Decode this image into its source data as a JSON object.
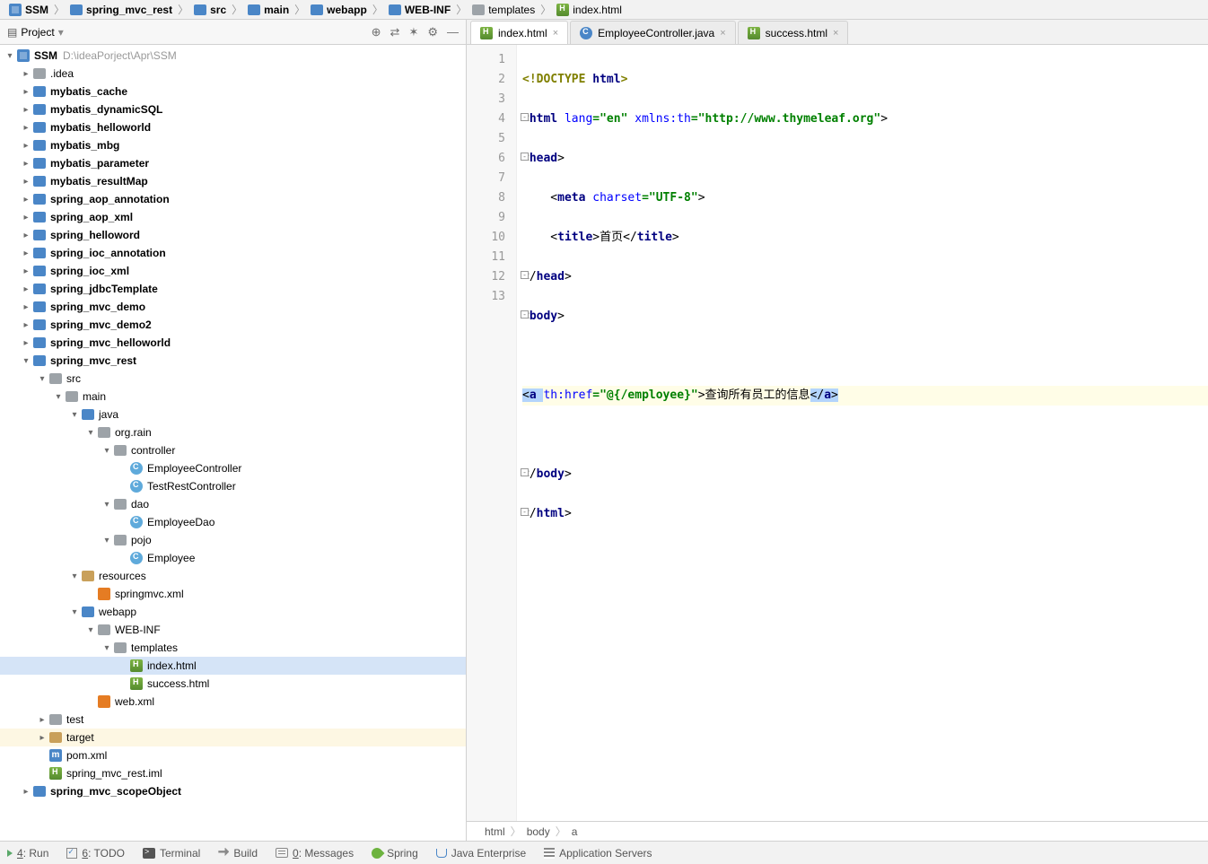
{
  "breadcrumbs": [
    {
      "icon": "sq",
      "label": "SSM"
    },
    {
      "icon": "folder-blue",
      "label": "spring_mvc_rest"
    },
    {
      "icon": "folder-blue",
      "label": "src"
    },
    {
      "icon": "folder-blue",
      "label": "main"
    },
    {
      "icon": "folder-blue",
      "label": "webapp"
    },
    {
      "icon": "folder-blue",
      "label": "WEB-INF"
    },
    {
      "icon": "folder-gray",
      "label": "templates"
    },
    {
      "icon": "html",
      "label": "index.html"
    }
  ],
  "project_panel": {
    "title": "Project",
    "tools": [
      "⊕",
      "⇄",
      "✶",
      "⚙",
      "—"
    ]
  },
  "tree": [
    {
      "depth": 0,
      "arrow": "down",
      "icon": "sq",
      "label": "SSM",
      "bold": true,
      "path": "D:\\ideaPorject\\Apr\\SSM"
    },
    {
      "depth": 1,
      "arrow": "right",
      "icon": "folder-gray",
      "label": ".idea"
    },
    {
      "depth": 1,
      "arrow": "right",
      "icon": "folder-blue",
      "label": "mybatis_cache",
      "bold": true
    },
    {
      "depth": 1,
      "arrow": "right",
      "icon": "folder-blue",
      "label": "mybatis_dynamicSQL",
      "bold": true
    },
    {
      "depth": 1,
      "arrow": "right",
      "icon": "folder-blue",
      "label": "mybatis_helloworld",
      "bold": true
    },
    {
      "depth": 1,
      "arrow": "right",
      "icon": "folder-blue",
      "label": "mybatis_mbg",
      "bold": true
    },
    {
      "depth": 1,
      "arrow": "right",
      "icon": "folder-blue",
      "label": "mybatis_parameter",
      "bold": true
    },
    {
      "depth": 1,
      "arrow": "right",
      "icon": "folder-blue",
      "label": "mybatis_resultMap",
      "bold": true
    },
    {
      "depth": 1,
      "arrow": "right",
      "icon": "folder-blue",
      "label": "spring_aop_annotation",
      "bold": true
    },
    {
      "depth": 1,
      "arrow": "right",
      "icon": "folder-blue",
      "label": "spring_aop_xml",
      "bold": true
    },
    {
      "depth": 1,
      "arrow": "right",
      "icon": "folder-blue",
      "label": "spring_helloword",
      "bold": true
    },
    {
      "depth": 1,
      "arrow": "right",
      "icon": "folder-blue",
      "label": "spring_ioc_annotation",
      "bold": true
    },
    {
      "depth": 1,
      "arrow": "right",
      "icon": "folder-blue",
      "label": "spring_ioc_xml",
      "bold": true
    },
    {
      "depth": 1,
      "arrow": "right",
      "icon": "folder-blue",
      "label": "spring_jdbcTemplate",
      "bold": true
    },
    {
      "depth": 1,
      "arrow": "right",
      "icon": "folder-blue",
      "label": "spring_mvc_demo",
      "bold": true
    },
    {
      "depth": 1,
      "arrow": "right",
      "icon": "folder-blue",
      "label": "spring_mvc_demo2",
      "bold": true
    },
    {
      "depth": 1,
      "arrow": "right",
      "icon": "folder-blue",
      "label": "spring_mvc_helloworld",
      "bold": true
    },
    {
      "depth": 1,
      "arrow": "down",
      "icon": "folder-blue",
      "label": "spring_mvc_rest",
      "bold": true
    },
    {
      "depth": 2,
      "arrow": "down",
      "icon": "folder-gray",
      "label": "src"
    },
    {
      "depth": 3,
      "arrow": "down",
      "icon": "folder-gray",
      "label": "main"
    },
    {
      "depth": 4,
      "arrow": "down",
      "icon": "folder-blue",
      "label": "java"
    },
    {
      "depth": 5,
      "arrow": "down",
      "icon": "folder-gray",
      "label": "org.rain"
    },
    {
      "depth": 6,
      "arrow": "down",
      "icon": "folder-gray",
      "label": "controller"
    },
    {
      "depth": 7,
      "arrow": "none",
      "icon": "class",
      "label": "EmployeeController"
    },
    {
      "depth": 7,
      "arrow": "none",
      "icon": "class",
      "label": "TestRestController"
    },
    {
      "depth": 6,
      "arrow": "down",
      "icon": "folder-gray",
      "label": "dao"
    },
    {
      "depth": 7,
      "arrow": "none",
      "icon": "class",
      "label": "EmployeeDao"
    },
    {
      "depth": 6,
      "arrow": "down",
      "icon": "folder-gray",
      "label": "pojo"
    },
    {
      "depth": 7,
      "arrow": "none",
      "icon": "class",
      "label": "Employee"
    },
    {
      "depth": 4,
      "arrow": "down",
      "icon": "folder-tan",
      "label": "resources"
    },
    {
      "depth": 5,
      "arrow": "none",
      "icon": "xml",
      "label": "springmvc.xml"
    },
    {
      "depth": 4,
      "arrow": "down",
      "icon": "folder-blue",
      "label": "webapp"
    },
    {
      "depth": 5,
      "arrow": "down",
      "icon": "folder-gray",
      "label": "WEB-INF"
    },
    {
      "depth": 6,
      "arrow": "down",
      "icon": "folder-gray",
      "label": "templates"
    },
    {
      "depth": 7,
      "arrow": "none",
      "icon": "html",
      "label": "index.html",
      "selected": true
    },
    {
      "depth": 7,
      "arrow": "none",
      "icon": "html",
      "label": "success.html"
    },
    {
      "depth": 5,
      "arrow": "none",
      "icon": "xml",
      "label": "web.xml"
    },
    {
      "depth": 2,
      "arrow": "right",
      "icon": "folder-gray",
      "label": "test"
    },
    {
      "depth": 2,
      "arrow": "right",
      "icon": "folder-tan",
      "label": "target",
      "excluded": true
    },
    {
      "depth": 2,
      "arrow": "none",
      "icon": "m",
      "label": "pom.xml",
      "mtext": "m"
    },
    {
      "depth": 2,
      "arrow": "none",
      "icon": "html",
      "label": "spring_mvc_rest.iml"
    },
    {
      "depth": 1,
      "arrow": "right",
      "icon": "folder-blue",
      "label": "spring_mvc_scopeObject",
      "bold": true
    }
  ],
  "tabs": [
    {
      "icon": "html",
      "label": "index.html",
      "active": true
    },
    {
      "icon": "java",
      "label": "EmployeeController.java"
    },
    {
      "icon": "html",
      "label": "success.html"
    }
  ],
  "gutter_lines": [
    "1",
    "2",
    "3",
    "4",
    "5",
    "6",
    "7",
    "8",
    "9",
    "10",
    "11",
    "12",
    "13"
  ],
  "code": {
    "l1": {
      "a": "<!DOCTYPE ",
      "b": "html",
      "c": ">"
    },
    "l2": {
      "a": "<",
      "b": "html ",
      "c": "lang",
      "d": "=\"en\" ",
      "e": "xmlns:th",
      "f": "=\"http://www.thymeleaf.org\"",
      "g": ">"
    },
    "l3": {
      "a": "<",
      "b": "head",
      "c": ">"
    },
    "l4": {
      "a": "    <",
      "b": "meta ",
      "c": "charset",
      "d": "=\"UTF-8\"",
      "e": ">"
    },
    "l5": {
      "a": "    <",
      "b": "title",
      "c": ">",
      "d": "首页",
      "e": "</",
      "f": "title",
      "g": ">"
    },
    "l6": {
      "a": "</",
      "b": "head",
      "c": ">"
    },
    "l7": {
      "a": "<",
      "b": "body",
      "c": ">"
    },
    "l9": {
      "a": "<",
      "b": "a ",
      "c": "th:href",
      "d": "=\"@{/employee}\"",
      "e": ">",
      "f": "查询所有员工的信息",
      "g": "</",
      "h": "a",
      "i": ">"
    },
    "l11": {
      "a": "</",
      "b": "body",
      "c": ">"
    },
    "l12": {
      "a": "</",
      "b": "html",
      "c": ">"
    }
  },
  "editor_crumbs": [
    "html",
    "body",
    "a"
  ],
  "bottom": [
    {
      "key": "run",
      "mn": "4",
      "label": ": Run",
      "icon": "tri"
    },
    {
      "key": "todo",
      "mn": "6",
      "label": ": TODO",
      "icon": "todo"
    },
    {
      "key": "terminal",
      "label": "Terminal",
      "icon": "terminal"
    },
    {
      "key": "build",
      "label": "Build",
      "icon": "hammer"
    },
    {
      "key": "messages",
      "mn": "0",
      "label": ": Messages",
      "icon": "msg"
    },
    {
      "key": "spring",
      "label": "Spring",
      "icon": "leaf"
    },
    {
      "key": "jee",
      "label": "Java Enterprise",
      "icon": "cup"
    },
    {
      "key": "appserv",
      "label": "Application Servers",
      "icon": "server"
    }
  ]
}
